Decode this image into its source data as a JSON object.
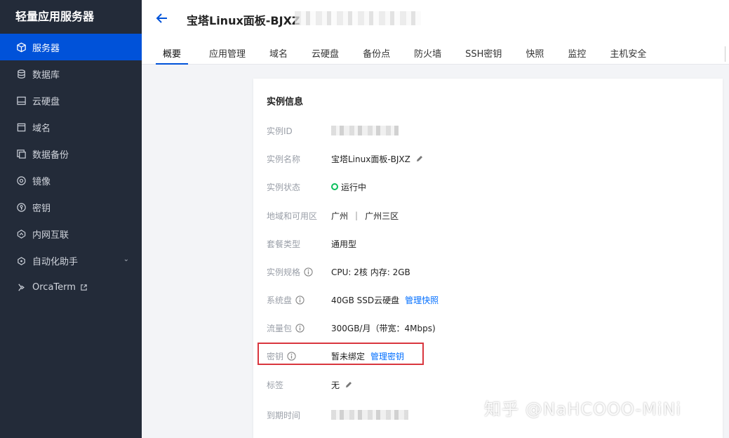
{
  "sidebar": {
    "brand": "轻量应用服务器",
    "items": [
      {
        "label": "服务器",
        "icon": "cube-icon",
        "active": true
      },
      {
        "label": "数据库",
        "icon": "database-icon"
      },
      {
        "label": "云硬盘",
        "icon": "disk-icon"
      },
      {
        "label": "域名",
        "icon": "domain-icon"
      },
      {
        "label": "数据备份",
        "icon": "backup-icon"
      },
      {
        "label": "镜像",
        "icon": "image-icon"
      },
      {
        "label": "密钥",
        "icon": "key-icon"
      },
      {
        "label": "内网互联",
        "icon": "network-icon"
      },
      {
        "label": "自动化助手",
        "icon": "automation-icon",
        "has_chevron": true
      },
      {
        "label": "OrcaTerm",
        "icon": "terminal-icon",
        "external": true
      }
    ]
  },
  "header": {
    "title": "宝塔Linux面板-BJXZ",
    "tabs": [
      "概要",
      "应用管理",
      "域名",
      "云硬盘",
      "备份点",
      "防火墙",
      "SSH密钥",
      "快照",
      "监控",
      "主机安全"
    ]
  },
  "card": {
    "title": "实例信息",
    "rows": {
      "id": {
        "label": "实例ID"
      },
      "name": {
        "label": "实例名称",
        "value": "宝塔Linux面板-BJXZ"
      },
      "status": {
        "label": "实例状态",
        "value": "运行中"
      },
      "region": {
        "label": "地域和可用区",
        "value": "广州",
        "separator": "|",
        "zone": "广州三区"
      },
      "plan": {
        "label": "套餐类型",
        "value": "通用型"
      },
      "spec": {
        "label": "实例规格",
        "value": "CPU: 2核 内存: 2GB"
      },
      "disk": {
        "label": "系统盘",
        "value": "40GB SSD云硬盘",
        "link": "管理快照"
      },
      "traffic": {
        "label": "流量包",
        "value": "300GB/月（带宽：4Mbps)"
      },
      "key": {
        "label": "密钥",
        "value": "暂未绑定",
        "link": "管理密钥"
      },
      "tags": {
        "label": "标签",
        "value": "无"
      },
      "expire": {
        "label": "到期时间"
      }
    }
  },
  "watermark": "知乎 @NaHCOOO-MiNi",
  "colors": {
    "accent": "#0052d9",
    "link": "#006eff",
    "running": "#0abf5b",
    "highlight": "#d9363e",
    "sidebar": "#232b39"
  }
}
